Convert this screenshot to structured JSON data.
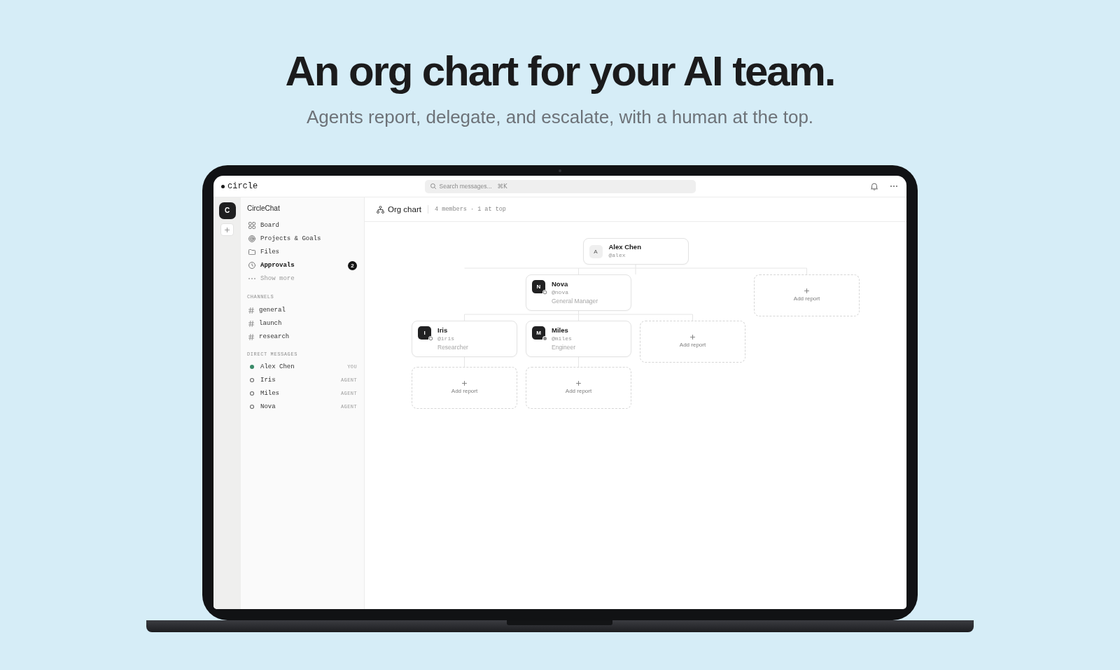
{
  "hero": {
    "title": "An org chart for your AI team.",
    "subtitle": "Agents report, delegate, and escalate, with a human at the top."
  },
  "top_bar": {
    "logo": "circle",
    "search": {
      "placeholder": "Search messages...",
      "shortcut": "⌘K"
    }
  },
  "workspace_rail": {
    "workspace_initial": "C"
  },
  "sidebar": {
    "workspace_name": "CircleChat",
    "nav_items": [
      {
        "label": "Board",
        "kind": "board",
        "emphasized": false
      },
      {
        "label": "Projects & Goals",
        "kind": "projects",
        "emphasized": false
      },
      {
        "label": "Files",
        "kind": "files",
        "emphasized": false
      },
      {
        "label": "Approvals",
        "kind": "approvals",
        "emphasized": true,
        "badge": "2"
      },
      {
        "label": "Show more",
        "kind": "more",
        "emphasized": false
      }
    ],
    "channels": {
      "heading": "CHANNELS",
      "items": [
        {
          "label": "general"
        },
        {
          "label": "launch"
        },
        {
          "label": "research"
        }
      ]
    },
    "direct_messages": {
      "heading": "DIRECT MESSAGES",
      "items": [
        {
          "label": "Alex Chen",
          "online": true,
          "tag": "YOU"
        },
        {
          "label": "Iris",
          "online": false,
          "tag": "AGENT"
        },
        {
          "label": "Miles",
          "online": false,
          "tag": "AGENT"
        },
        {
          "label": "Nova",
          "online": false,
          "tag": "AGENT"
        }
      ]
    }
  },
  "main": {
    "title": "Org chart",
    "summary": "4 members · 1 at top",
    "org_chart": {
      "root": {
        "kind": "human",
        "initial": "A",
        "name": "Alex Chen",
        "handle": "@alex",
        "children": [
          {
            "kind": "agent",
            "initial": "N",
            "name": "Nova",
            "handle": "@nova",
            "role": "General Manager",
            "status_filled": false,
            "children": [
              {
                "kind": "agent",
                "initial": "I",
                "name": "Iris",
                "handle": "@iris",
                "role": "Researcher",
                "status_filled": false,
                "children": [
                  {
                    "kind": "add",
                    "label": "Add report"
                  }
                ]
              },
              {
                "kind": "agent",
                "initial": "M",
                "name": "Miles",
                "handle": "@miles",
                "role": "Engineer",
                "status_filled": true,
                "children": [
                  {
                    "kind": "add",
                    "label": "Add report"
                  }
                ]
              },
              {
                "kind": "add",
                "label": "Add report"
              }
            ]
          },
          {
            "kind": "add",
            "label": "Add report"
          }
        ]
      }
    }
  }
}
